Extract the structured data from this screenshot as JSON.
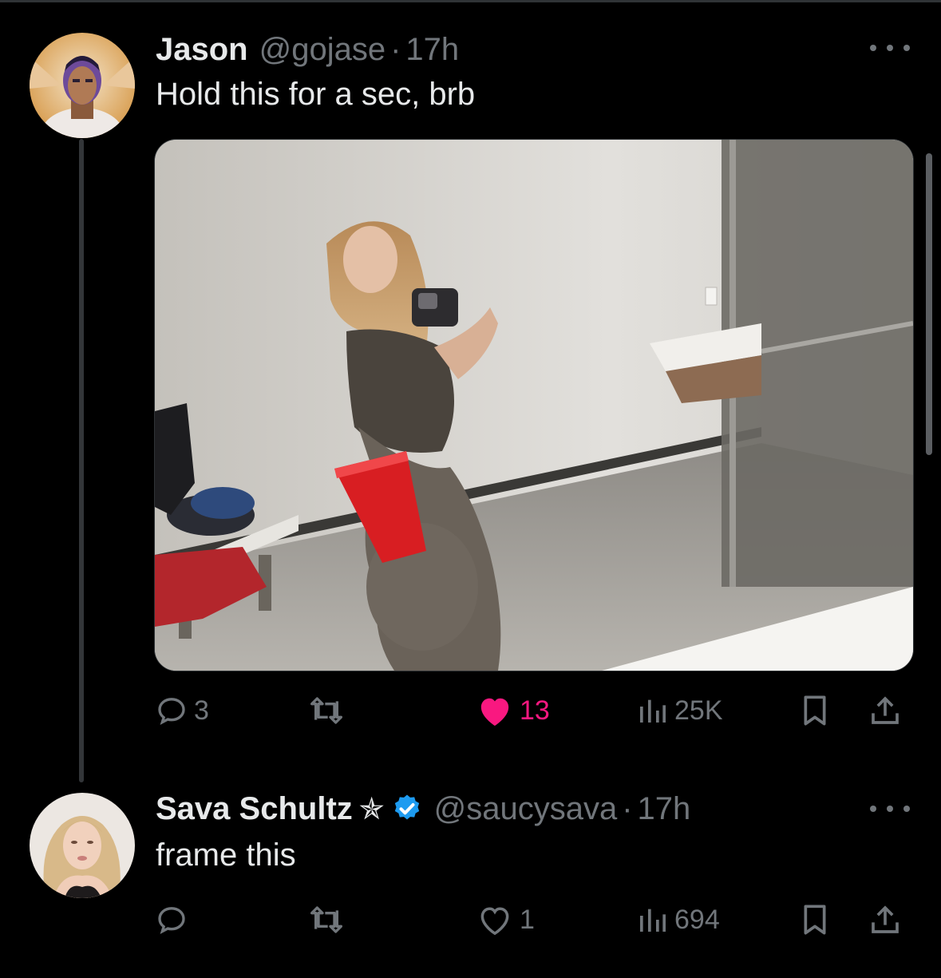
{
  "tweet1": {
    "name": "Jason",
    "handle": "@gojase",
    "separator": "·",
    "time": "17h",
    "text": "Hold this for a sec, brb",
    "media_alt": "photo",
    "actions": {
      "replies": "3",
      "retweets": "",
      "likes": "13",
      "views": "25K"
    }
  },
  "tweet2": {
    "name": "Sava Schultz",
    "name_symbol": "✯",
    "handle": "@saucysava",
    "separator": "·",
    "time": "17h",
    "text": "frame this",
    "actions": {
      "replies": "",
      "retweets": "",
      "likes": "1",
      "views": "694"
    }
  },
  "icons": {
    "more": "more-icon",
    "reply": "reply-icon",
    "retweet": "retweet-icon",
    "like": "heart-icon",
    "views": "views-icon",
    "bookmark": "bookmark-icon",
    "share": "share-icon",
    "verified": "verified-badge-icon"
  },
  "colors": {
    "background": "#000000",
    "text": "#e7e9ea",
    "muted": "#71767b",
    "like": "#f91880",
    "verified": "#1d9bf0"
  }
}
